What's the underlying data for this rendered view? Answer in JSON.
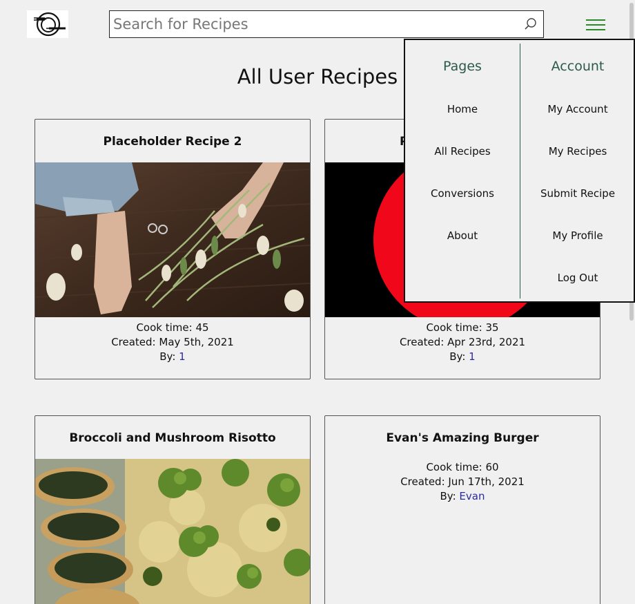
{
  "header": {
    "logo_icon": "plate-fork-knife-logo",
    "search_placeholder": "Search for Recipes",
    "search_icon": "search-icon",
    "menu_icon": "hamburger-icon",
    "menu_color": "#2a8a2a"
  },
  "page_title": "All User Recipes",
  "recipes": [
    {
      "title": "Placeholder Recipe 2",
      "cook_time": "Cook time: 45",
      "created": "Created: May 5th, 2021",
      "by_label": "By: ",
      "author": "1",
      "image": "hands-arranging-flowers-on-wood-table"
    },
    {
      "title": "P",
      "cook_time": "Cook time: 35",
      "created": "Created: Apr 23rd, 2021",
      "by_label": "By: ",
      "author": "1",
      "image": "red-circle-on-black"
    },
    {
      "title": "Broccoli and Mushroom Risotto",
      "cook_time": "",
      "created": "",
      "by_label": "",
      "author": "",
      "image": "risotto-with-broccoli-and-breaded-zucchini"
    },
    {
      "title": "Evan's Amazing Burger",
      "cook_time": "Cook time: 60",
      "created": "Created: Jun 17th, 2021",
      "by_label": "By: ",
      "author": "Evan",
      "image": ""
    }
  ],
  "menu": {
    "pages_heading": "Pages",
    "pages": [
      "Home",
      "All Recipes",
      "Conversions",
      "About"
    ],
    "account_heading": "Account",
    "account": [
      "My Account",
      "My Recipes",
      "Submit Recipe",
      "My Profile",
      "Log Out"
    ],
    "accent": "#2c5a4a"
  },
  "colors": {
    "background": "#f0f0f0",
    "link": "#2a2aa0"
  }
}
